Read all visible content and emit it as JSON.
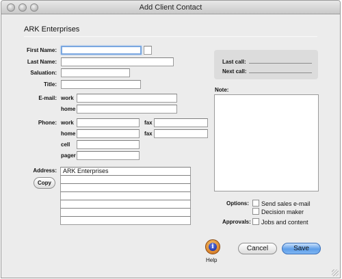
{
  "window": {
    "title": "Add Client Contact"
  },
  "client": {
    "name": "ARK Enterprises"
  },
  "labels": {
    "first_name": "First Name:",
    "last_name": "Last Name:",
    "salutation": "Saluation:",
    "title": "Title:",
    "email": "E-mail:",
    "phone": "Phone:",
    "address": "Address:",
    "last_call": "Last call:",
    "next_call": "Next call:",
    "note": "Note:",
    "options": "Options:",
    "approvals": "Approvals:"
  },
  "sublabels": {
    "email_work": "work",
    "email_home": "home",
    "phone_work": "work",
    "phone_home": "home",
    "phone_cell": "cell",
    "phone_pager": "pager",
    "fax_work": "fax",
    "fax_home": "fax"
  },
  "fields": {
    "first_name": "",
    "middle_initial": "",
    "last_name": "",
    "salutation": "",
    "title": "",
    "email_work": "",
    "email_home": "",
    "phone_work": "",
    "fax_work": "",
    "phone_home": "",
    "fax_home": "",
    "phone_cell": "",
    "phone_pager": "",
    "address_lines": [
      "ARK Enterprises",
      "",
      "",
      "",
      "",
      "",
      ""
    ]
  },
  "options": {
    "send_sales_email": {
      "label": "Send sales e-mail",
      "checked": false
    },
    "decision_maker": {
      "label": "Decision maker",
      "checked": false
    }
  },
  "approvals": {
    "jobs_and_content": {
      "label": "Jobs and content",
      "checked": false
    }
  },
  "buttons": {
    "copy": "Copy",
    "help": "Help",
    "cancel": "Cancel",
    "save": "Save"
  },
  "colors": {
    "window_bg": "#ececec",
    "default_button": "#5f9ee8",
    "focus_ring": "#7aa7e0"
  }
}
